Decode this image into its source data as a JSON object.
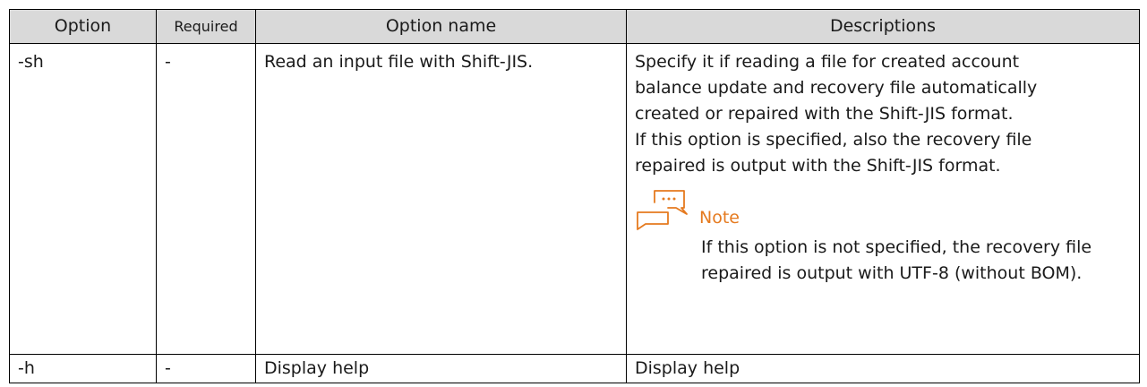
{
  "headers": {
    "option": "Option",
    "required": "Required",
    "option_name": "Option name",
    "descriptions": "Descriptions"
  },
  "rows": [
    {
      "option": "-sh",
      "required": "-",
      "option_name": "Read an input file with Shift-JIS.",
      "description_lines": [
        "Specify it if reading a file for created account",
        "balance update and recovery file automatically",
        "created or repaired with the Shift-JIS format.",
        "If this option is specified, also the recovery file",
        "repaired is output with the Shift-JIS format."
      ],
      "note": {
        "icon": "note-icon",
        "title": "Note",
        "text": "If this option is not specified, the recovery file repaired is output with UTF-8 (without BOM)."
      }
    },
    {
      "option": "-h",
      "required": "-",
      "option_name": "Display help",
      "description": "Display help"
    }
  ],
  "colors": {
    "header_bg": "#d9d9d9",
    "note_accent": "#e57a1f",
    "border": "#000000"
  }
}
